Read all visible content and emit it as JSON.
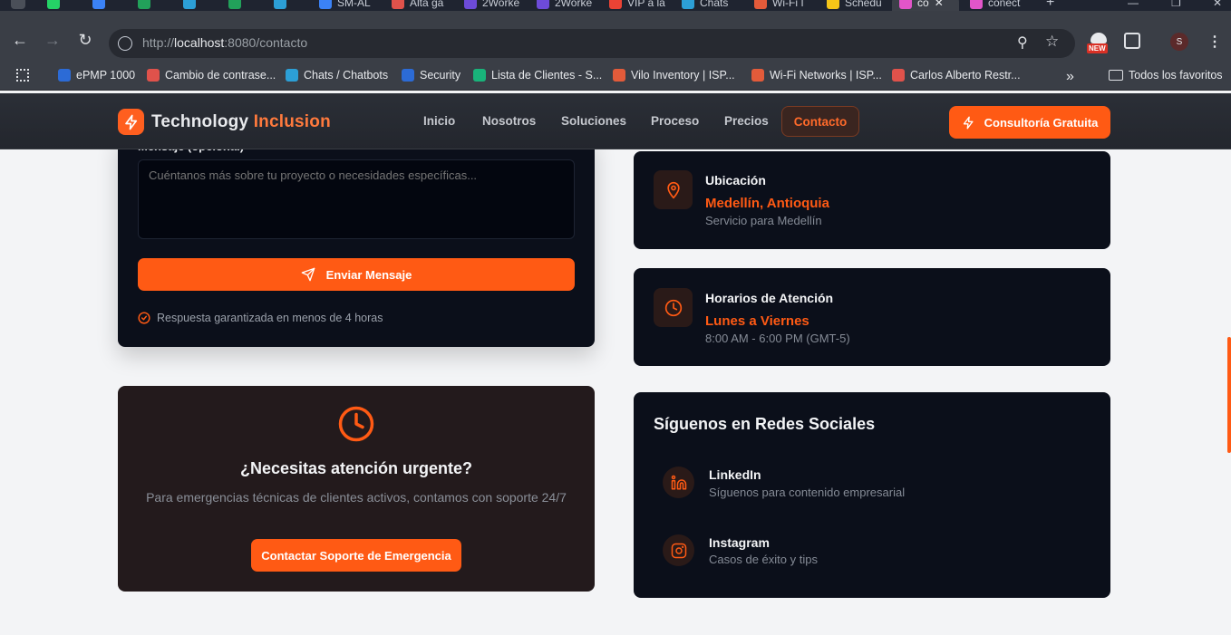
{
  "browser": {
    "tabs": [
      {
        "label": "",
        "badge": "35",
        "color": "#25d366"
      },
      {
        "label": "",
        "color": "#3b82f6"
      },
      {
        "label": "",
        "color": "#22a15a"
      },
      {
        "label": "",
        "color": "#2c9fd6"
      },
      {
        "label": "",
        "color": "#22a15a"
      },
      {
        "label": "",
        "color": "#2c9fd6"
      },
      {
        "label": "SM-AL",
        "color": "#3b82f6"
      },
      {
        "label": "Alta ga",
        "color": "#e0524b"
      },
      {
        "label": "2Worke",
        "color": "#6d4bd8"
      },
      {
        "label": "2Worke",
        "color": "#6d4bd8"
      },
      {
        "label": "VIP a la",
        "color": "#ea4335"
      },
      {
        "label": "Chats",
        "color": "#2c9fd6"
      },
      {
        "label": "Wi-Fi I",
        "color": "#e35b3a"
      },
      {
        "label": "Schedu",
        "color": "#f5c518"
      },
      {
        "label": "co",
        "color": "#e255c9",
        "active": true
      },
      {
        "label": "conect",
        "color": "#e255c9"
      }
    ],
    "new_tab": "+",
    "url_scheme": "http://",
    "url_host": "localhost",
    "url_rest": ":8080/contacto",
    "new_badge": "NEW",
    "profile_initial": "S",
    "bookmarks": [
      {
        "label": "ePMP 1000",
        "color": "#2c6bd6"
      },
      {
        "label": "Cambio de contrase...",
        "color": "#e0524b"
      },
      {
        "label": "Chats / Chatbots",
        "color": "#2c9fd6"
      },
      {
        "label": "Security",
        "color": "#2c6bd6"
      },
      {
        "label": "Lista de Clientes - S...",
        "color": "#19b37a"
      },
      {
        "label": "Vilo Inventory | ISP...",
        "color": "#e35b3a"
      },
      {
        "label": "Wi-Fi Networks | ISP...",
        "color": "#e35b3a"
      },
      {
        "label": "Carlos Alberto Restr...",
        "color": "#e0524b"
      }
    ],
    "more": "»",
    "all_bookmarks": "Todos los favoritos"
  },
  "site": {
    "brand_main": "Technology ",
    "brand_accent": "Inclusion",
    "nav": [
      "Inicio",
      "Nosotros",
      "Soluciones",
      "Proceso",
      "Precios",
      "Contacto"
    ],
    "cta": "Consultoría Gratuita",
    "accent_color": "#ff5a14"
  },
  "form": {
    "message_label": "Mensaje (opcional)",
    "message_placeholder": "Cuéntanos más sobre tu proyecto o necesidades específicas...",
    "send_label": "Enviar Mensaje",
    "guarantee": "Respuesta garantizada en menos de 4 horas"
  },
  "urgent": {
    "title": "¿Necesitas atención urgente?",
    "text": "Para emergencias técnicas de clientes activos, contamos con soporte 24/7",
    "button": "Contactar Soporte de Emergencia"
  },
  "location": {
    "title": "Ubicación",
    "accent": "Medellín, Antioquia",
    "sub": "Servicio para Medellín"
  },
  "hours": {
    "title": "Horarios de Atención",
    "accent": "Lunes a Viernes",
    "sub": "8:00 AM - 6:00 PM (GMT-5)"
  },
  "social": {
    "title": "Síguenos en Redes Sociales",
    "items": [
      {
        "name": "LinkedIn",
        "sub": "Síguenos para contenido empresarial"
      },
      {
        "name": "Instagram",
        "sub": "Casos de éxito y tips"
      }
    ]
  }
}
